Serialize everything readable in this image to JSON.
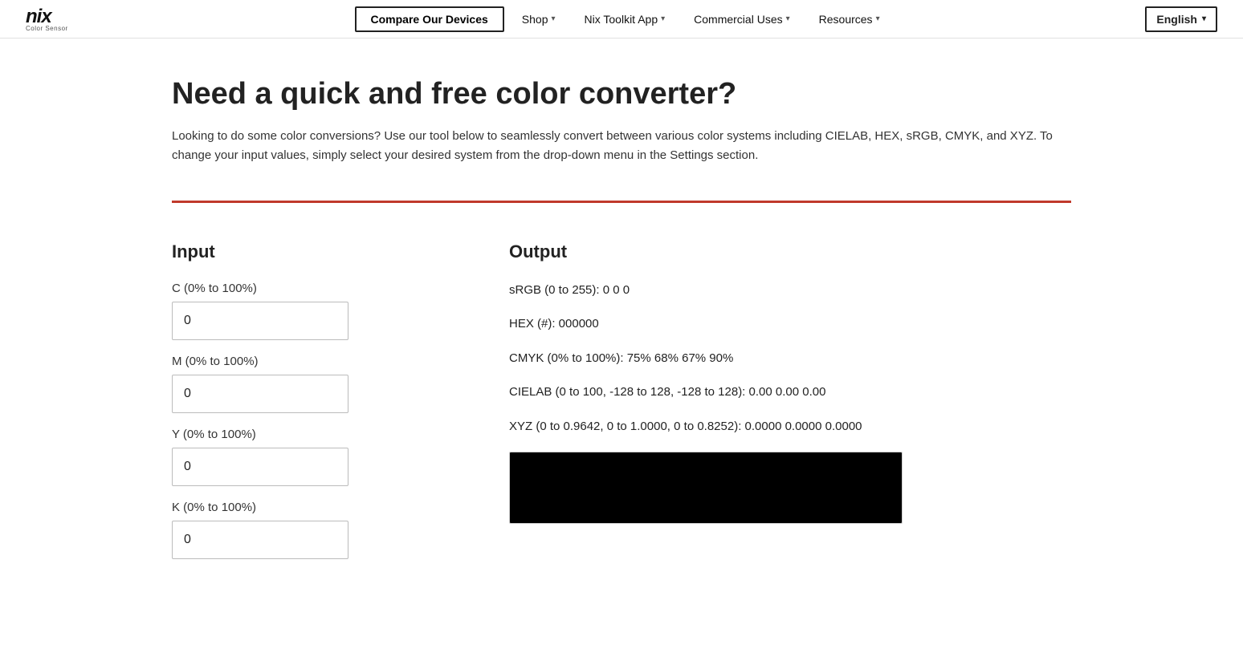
{
  "nav": {
    "logo_main": "nix",
    "logo_sub": "Color Sensor",
    "compare_label": "Compare Our Devices",
    "shop_label": "Shop",
    "toolkit_label": "Nix Toolkit App",
    "commercial_label": "Commercial Uses",
    "resources_label": "Resources",
    "language_label": "English"
  },
  "page": {
    "title": "Need a quick and free color converter?",
    "subtitle": "Looking to do some color conversions? Use our tool below to seamlessly convert between various color systems including CIELAB, HEX, sRGB, CMYK, and XYZ. To change your input values, simply select your desired system from the drop-down menu in the Settings section."
  },
  "input_section": {
    "title": "Input",
    "fields": [
      {
        "label": "C (0% to 100%)",
        "value": "0",
        "placeholder": "0"
      },
      {
        "label": "M (0% to 100%)",
        "value": "0",
        "placeholder": "0"
      },
      {
        "label": "Y (0% to 100%)",
        "value": "0",
        "placeholder": "0"
      },
      {
        "label": "K (0% to 100%)",
        "value": "0",
        "placeholder": "0"
      }
    ]
  },
  "output_section": {
    "title": "Output",
    "rows": [
      {
        "label": "sRGB (0 to 255): 0 0 0"
      },
      {
        "label": "HEX (#): 000000"
      },
      {
        "label": "CMYK (0% to 100%): 75% 68% 67% 90%"
      },
      {
        "label": "CIELAB (0 to 100, -128 to 128, -128 to 128): 0.00 0.00 0.00"
      },
      {
        "label": "XYZ (0 to 0.9642, 0 to 1.0000, 0 to 0.8252): 0.0000 0.0000 0.0000"
      }
    ],
    "color_preview_bg": "#000000"
  }
}
